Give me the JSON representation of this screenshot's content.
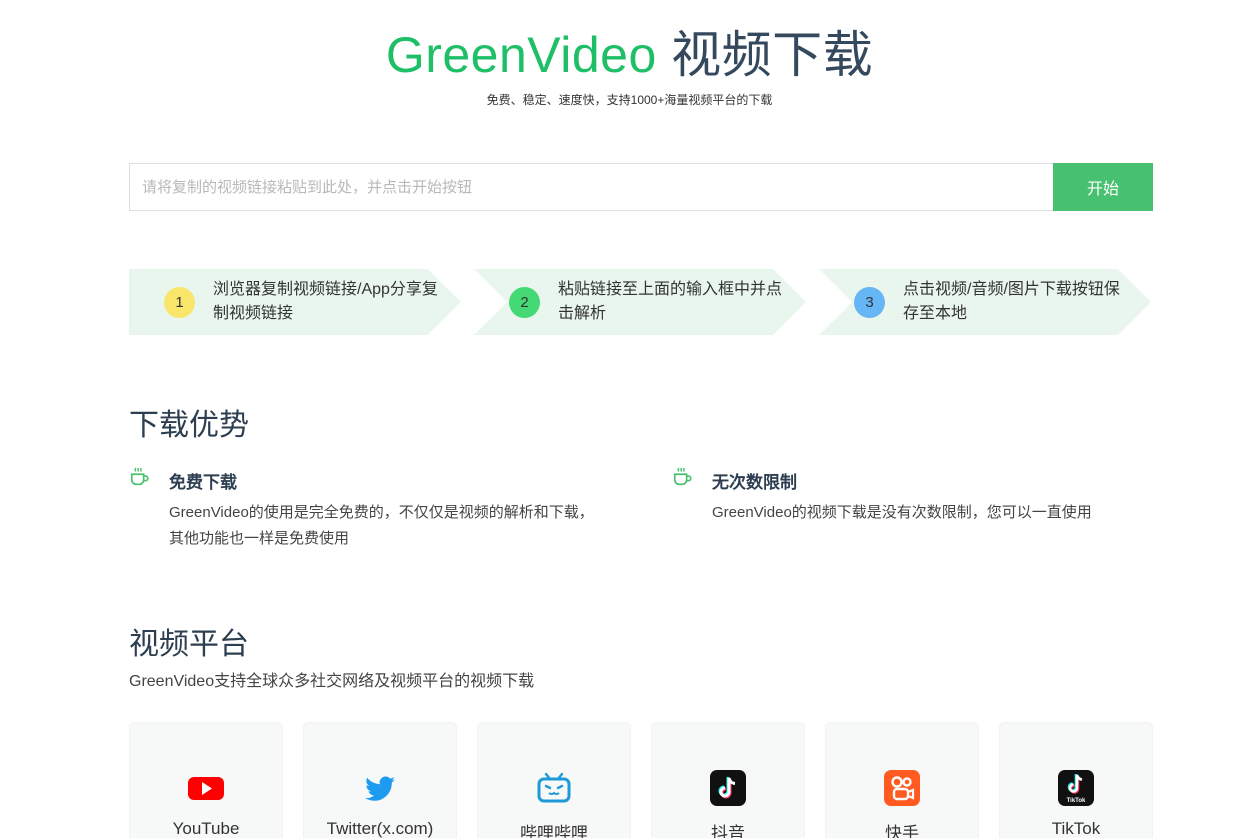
{
  "hero": {
    "brand": "GreenVideo",
    "title_rest": "视频下载",
    "subtitle": "免费、稳定、速度快，支持1000+海量视频平台的下载"
  },
  "search": {
    "placeholder": "请将复制的视频链接粘贴到此处，并点击开始按钮",
    "value": "",
    "button_label": "开始"
  },
  "steps": [
    {
      "number": "1",
      "text": "浏览器复制视频链接/App分享复制视频链接",
      "color": "#f8e56a"
    },
    {
      "number": "2",
      "text": "粘贴链接至上面的输入框中并点击解析",
      "color": "#45d976"
    },
    {
      "number": "3",
      "text": "点击视频/音频/图片下载按钮保存至本地",
      "color": "#66b5f4"
    }
  ],
  "advantages": {
    "title": "下载优势",
    "items": [
      {
        "icon": "cup-icon",
        "title": "免费下载",
        "desc": "GreenVideo的使用是完全免费的，不仅仅是视频的解析和下载，其他功能也一样是免费使用"
      },
      {
        "icon": "cup-icon",
        "title": "无次数限制",
        "desc": "GreenVideo的视频下载是没有次数限制，您可以一直使用"
      }
    ]
  },
  "platforms": {
    "title": "视频平台",
    "desc": "GreenVideo支持全球众多社交网络及视频平台的视频下载",
    "items": [
      {
        "name": "YouTube",
        "icon": "youtube-icon"
      },
      {
        "name": "Twitter(x.com)",
        "icon": "twitter-icon"
      },
      {
        "name": "哔哩哔哩",
        "icon": "bilibili-icon"
      },
      {
        "name": "抖音",
        "icon": "douyin-icon"
      },
      {
        "name": "快手",
        "icon": "kuaishou-icon"
      },
      {
        "name": "TikTok",
        "icon": "tiktok-icon"
      }
    ]
  },
  "colors": {
    "brand_green": "#1fbf68",
    "button_green": "#47c06f",
    "step_bg": "#e9f6ee",
    "heading": "#2c3e50"
  }
}
